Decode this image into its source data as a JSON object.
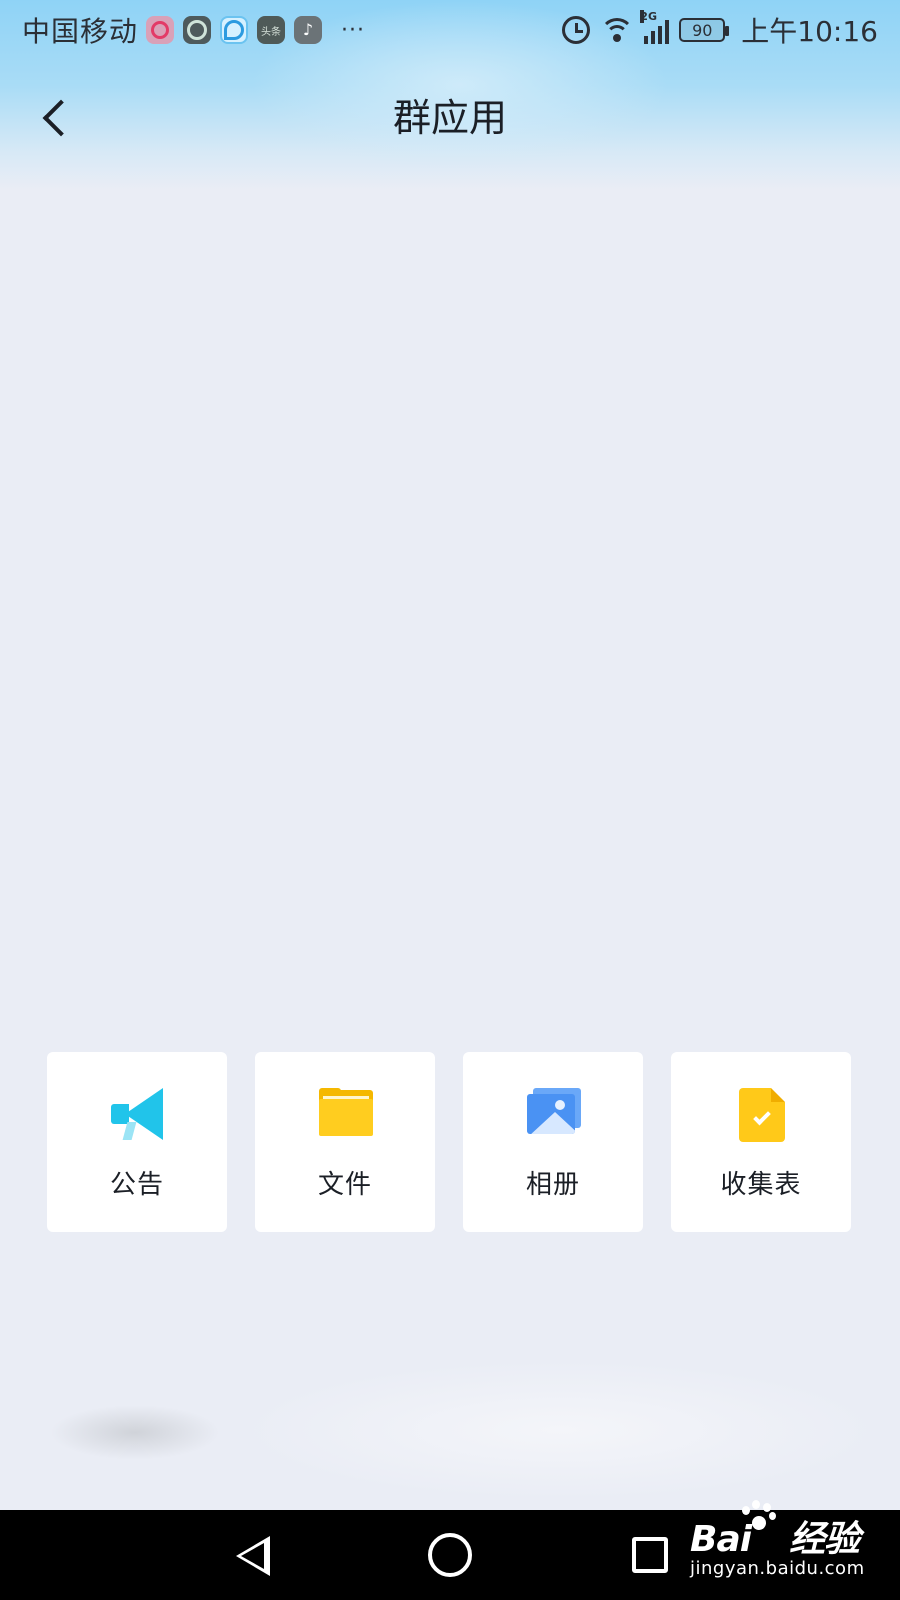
{
  "status_bar": {
    "carrier": "中国移动",
    "notification_icons": [
      "music-app-icon",
      "browser-app-icon",
      "qq-app-icon",
      "toutiao-app-icon",
      "tiktok-app-icon"
    ],
    "toutiao_label": "头条",
    "more": "···",
    "network": "2G",
    "battery": "90",
    "time": "上午10:16"
  },
  "header": {
    "title": "群应用",
    "back_icon": "chevron-left-icon"
  },
  "apps": [
    {
      "label": "公告",
      "icon": "megaphone-icon",
      "color": "#21c4ea"
    },
    {
      "label": "文件",
      "icon": "folder-icon",
      "color": "#ffcd1f"
    },
    {
      "label": "相册",
      "icon": "photo-album-icon",
      "color": "#4a92f3"
    },
    {
      "label": "收集表",
      "icon": "form-check-icon",
      "color": "#ffc919"
    }
  ],
  "system_nav": {
    "back_icon": "triangle-back-icon",
    "home_icon": "circle-home-icon",
    "recent_icon": "square-recent-icon"
  },
  "watermark": {
    "brand": "Bai",
    "brand_cn": "经验",
    "url": "jingyan.baidu.com"
  },
  "colors": {
    "header_blue": "#8fd3f6",
    "page_bg": "#eaedf5",
    "nav_bar": "#000000"
  }
}
